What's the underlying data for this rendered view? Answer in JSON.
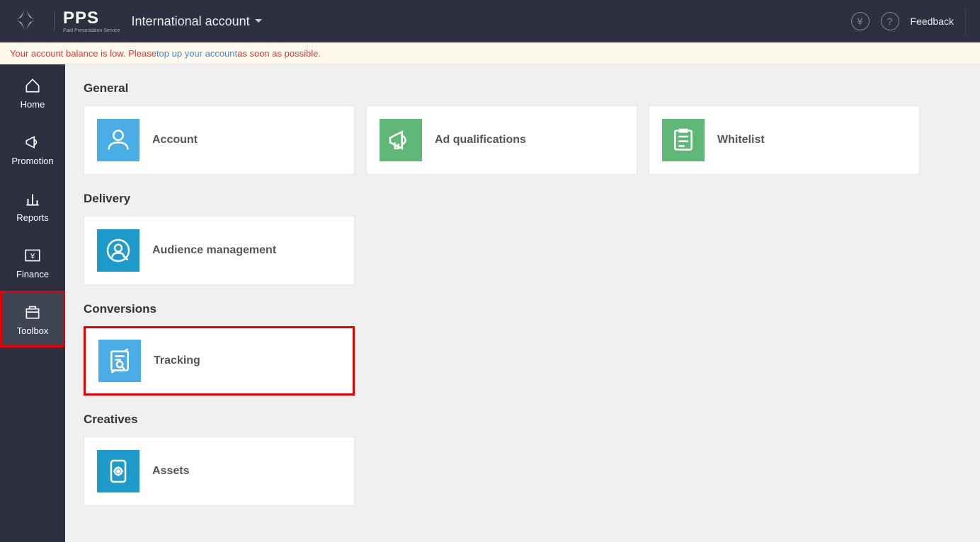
{
  "header": {
    "brand_main": "PPS",
    "brand_sub": "Paid Presentation Service",
    "account_label": "International account",
    "feedback": "Feedback"
  },
  "warning": {
    "prefix": "Your account balance is low. Please ",
    "link": "top up your account",
    "suffix": " as soon as possible."
  },
  "nav": {
    "home": "Home",
    "promotion": "Promotion",
    "reports": "Reports",
    "finance": "Finance",
    "toolbox": "Toolbox"
  },
  "sections": {
    "general": {
      "title": "General",
      "cards": {
        "account": "Account",
        "ad_qualifications": "Ad qualifications",
        "whitelist": "Whitelist"
      }
    },
    "delivery": {
      "title": "Delivery",
      "cards": {
        "audience": "Audience management"
      }
    },
    "conversions": {
      "title": "Conversions",
      "cards": {
        "tracking": "Tracking"
      }
    },
    "creatives": {
      "title": "Creatives",
      "cards": {
        "assets": "Assets"
      }
    }
  }
}
